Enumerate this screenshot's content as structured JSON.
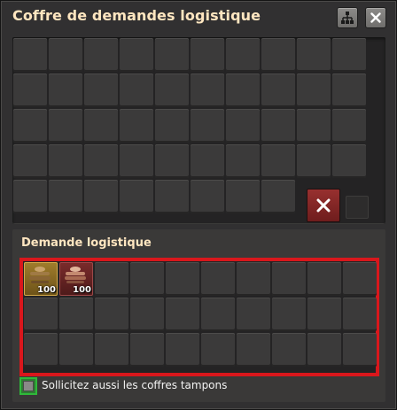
{
  "window": {
    "title": "Coffre de demandes logistique",
    "network_button_icon": "logistic-network-icon",
    "close_button_icon": "close-icon"
  },
  "inventory": {
    "rows": 5,
    "cols": 10,
    "clear_button_icon": "x-icon"
  },
  "request_section": {
    "title": "Demande logistique",
    "rows": 3,
    "cols": 10,
    "filled_slots": [
      {
        "item": "wood-item-icon",
        "count": "100"
      },
      {
        "item": "copper-ore-item-icon",
        "count": "100"
      }
    ]
  },
  "buffer_option": {
    "label": "Sollicitez aussi les coffres tampons",
    "checked": false
  },
  "colors": {
    "highlight_red": "#d9171c",
    "highlight_green": "#2fb93a",
    "title_color": "#ffe6c0"
  }
}
